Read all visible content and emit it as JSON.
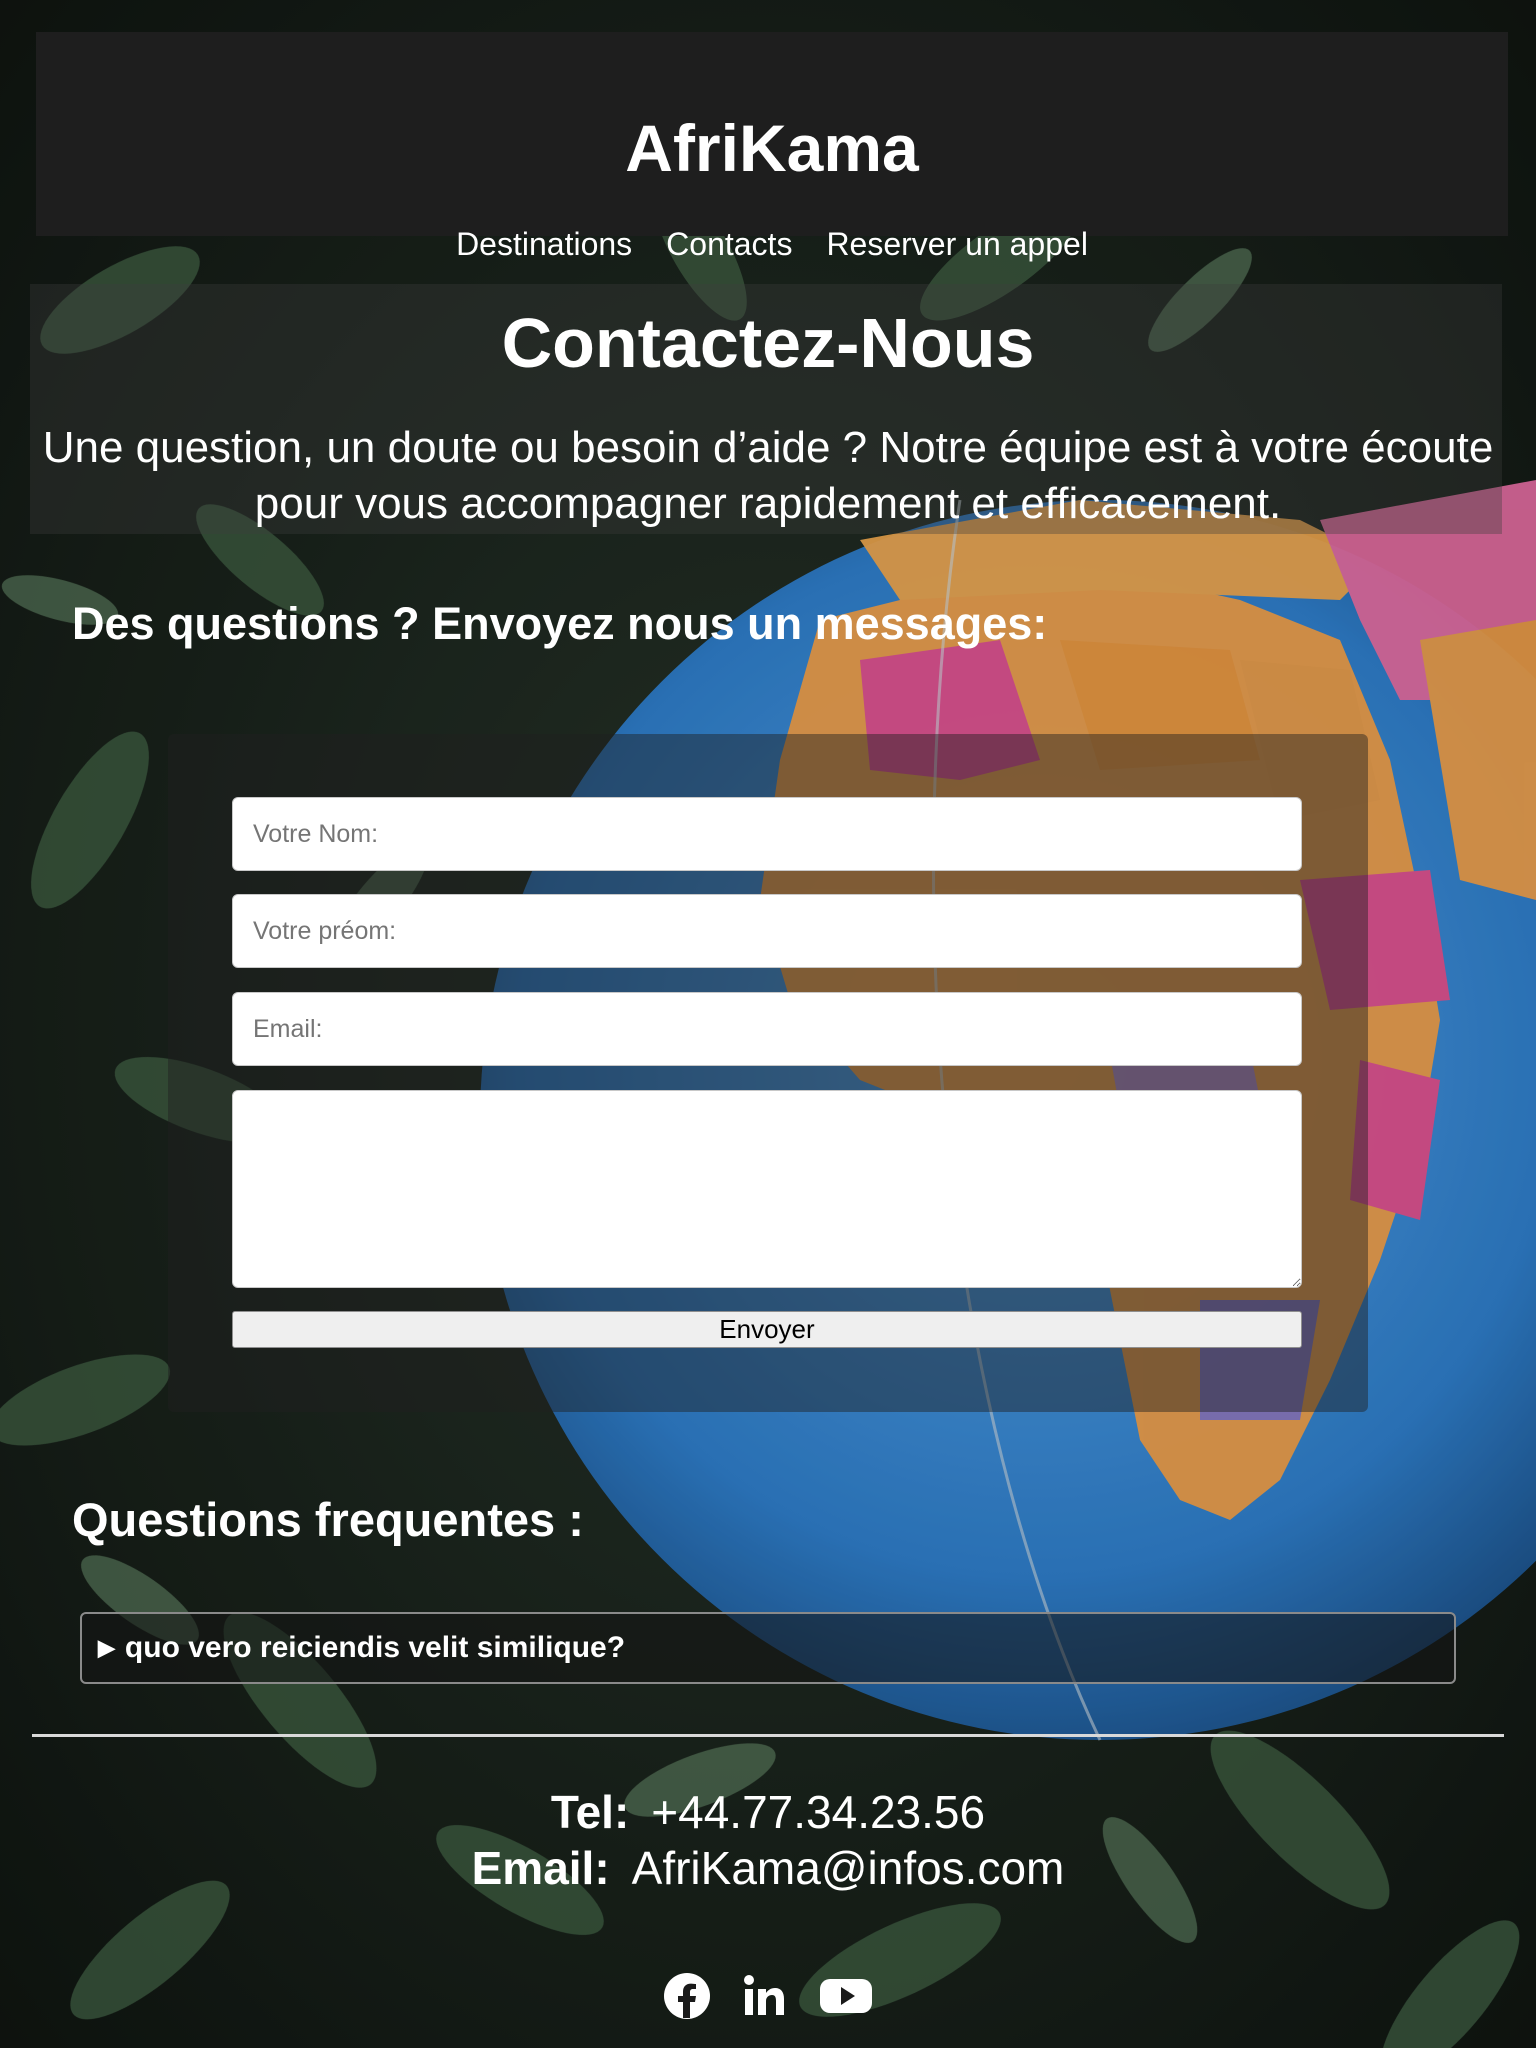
{
  "header": {
    "brand": "AfriKama",
    "nav": [
      {
        "label": "Destinations"
      },
      {
        "label": "Contacts"
      },
      {
        "label": "Reserver un appel"
      }
    ]
  },
  "hero": {
    "title": "Contactez-Nous",
    "text": "Une question, un doute ou besoin d’aide ? Notre équipe est à votre écoute pour vous accompagner rapidement et efficacement."
  },
  "contact_form": {
    "heading": "Des questions ? Envoyez nous un messages:",
    "nom_placeholder": "Votre Nom:",
    "prenom_placeholder": "Votre préom:",
    "email_placeholder": "Email:",
    "message_placeholder": "",
    "submit_label": "Envoyer"
  },
  "faq": {
    "heading": "Questions frequentes :",
    "items": [
      {
        "question": "quo vero reiciendis velit similique?"
      }
    ]
  },
  "footer": {
    "tel_label": "Tel:",
    "tel_value": "+44.77.34.23.56",
    "email_label": "Email:",
    "email_value": "AfriKama@infos.com",
    "socials": [
      {
        "icon": "facebook-icon"
      },
      {
        "icon": "linkedin-icon"
      },
      {
        "icon": "youtube-icon"
      }
    ]
  },
  "colors": {
    "header_bg": "#1e1e1e",
    "text": "#ffffff",
    "foliage": "#2f4a33",
    "globe_ocean": "#3a8fd8"
  }
}
